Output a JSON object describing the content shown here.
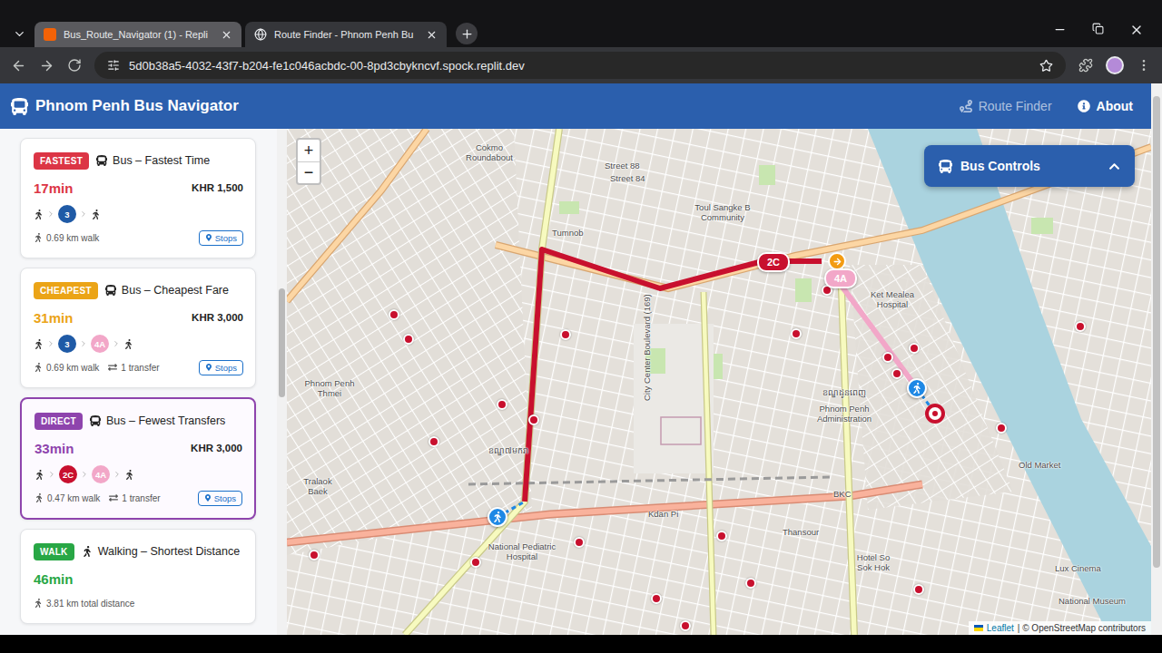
{
  "browser": {
    "tabs": [
      {
        "title": "Bus_Route_Navigator (1) - Repli",
        "selected": false
      },
      {
        "title": "Route Finder - Phnom Penh Bu",
        "selected": true
      }
    ],
    "url": "5d0b38a5-4032-43f7-b204-fe1c046acbdc-00-8pd3cbykncvf.spock.replit.dev"
  },
  "app": {
    "title": "Phnom Penh Bus Navigator",
    "nav": [
      {
        "label": "Route Finder",
        "selected": true
      },
      {
        "label": "About",
        "selected": false
      }
    ]
  },
  "routes": [
    {
      "kind": "bus",
      "badge": "FASTEST",
      "color": "#dc3545",
      "title": "Bus – Fastest Time",
      "time": "17min",
      "fare": "KHR 1,500",
      "legs": [
        {
          "kind": "walk"
        },
        {
          "kind": "bus",
          "label": "3",
          "color": "#1f5aa6"
        },
        {
          "kind": "walk"
        }
      ],
      "walk": "0.69 km walk",
      "stops": "Stops",
      "selected": false
    },
    {
      "kind": "bus",
      "badge": "CHEAPEST",
      "color": "#eba417",
      "title": "Bus – Cheapest Fare",
      "time": "31min",
      "fare": "KHR 3,000",
      "legs": [
        {
          "kind": "walk"
        },
        {
          "kind": "bus",
          "label": "3",
          "color": "#1f5aa6"
        },
        {
          "kind": "bus",
          "label": "4A",
          "color": "#f2a7c8"
        },
        {
          "kind": "walk"
        }
      ],
      "walk": "0.69 km walk",
      "transfers": "1 transfer",
      "stops": "Stops",
      "selected": false
    },
    {
      "kind": "bus",
      "badge": "DIRECT",
      "color": "#8e44ad",
      "title": "Bus – Fewest Transfers",
      "time": "33min",
      "fare": "KHR 3,000",
      "legs": [
        {
          "kind": "walk"
        },
        {
          "kind": "bus",
          "label": "2C",
          "color": "#c8102e"
        },
        {
          "kind": "bus",
          "label": "4A",
          "color": "#f2a7c8"
        },
        {
          "kind": "walk"
        }
      ],
      "walk": "0.47 km walk",
      "transfers": "1 transfer",
      "stops": "Stops",
      "selected": true
    },
    {
      "kind": "walk",
      "badge": "WALK",
      "color": "#28a745",
      "title": "Walking – Shortest Distance",
      "time": "46min",
      "distance": "3.81 km total distance",
      "selected": false
    }
  ],
  "map": {
    "zoom_in": "+",
    "zoom_out": "−",
    "controls_title": "Bus Controls",
    "route_tags": [
      {
        "label": "2C",
        "color": "#c8102e"
      },
      {
        "label": "4A",
        "color": "#f2a7c8"
      }
    ],
    "labels": [
      {
        "text": "Cokmo Roundabout"
      },
      {
        "text": "Street 88"
      },
      {
        "text": "Street 84"
      },
      {
        "text": "Toul Sangke B Community"
      },
      {
        "text": "Phnom Penh Thmei"
      },
      {
        "text": "Tralaok Baek"
      },
      {
        "text": "ខណ្ឌ៧មករា"
      },
      {
        "text": "City Center Boulevard (169)"
      },
      {
        "text": "Kdan Pi"
      },
      {
        "text": "National Pediatric Hospital"
      },
      {
        "text": "Thansour"
      },
      {
        "text": "BKC"
      },
      {
        "text": "ខណ្ឌដូនពេញ"
      },
      {
        "text": "Phnom Penh Administration"
      },
      {
        "text": "Ket Mealea Hospital"
      },
      {
        "text": "Old Market"
      },
      {
        "text": "Hotel So Sok Hok"
      },
      {
        "text": "Lux Cinema"
      },
      {
        "text": "National Museum"
      },
      {
        "text": "Tumnob"
      }
    ],
    "attribution_leaflet": "Leaflet",
    "attribution": "| © OpenStreetMap contributors"
  }
}
